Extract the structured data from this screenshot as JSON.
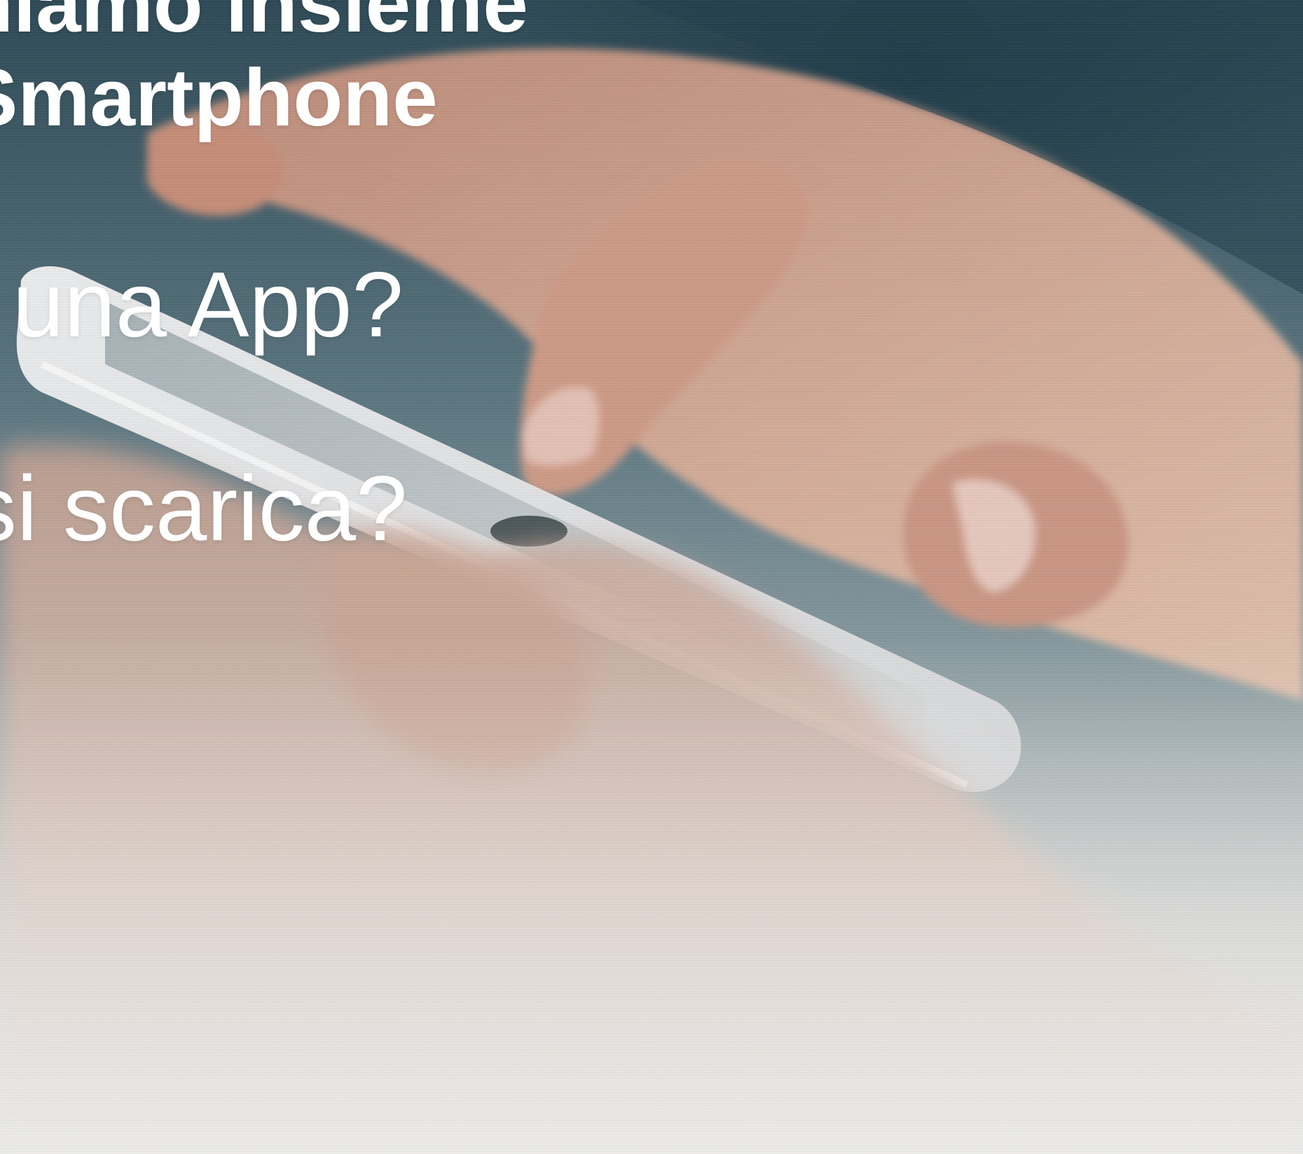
{
  "slide": {
    "title_lines": [
      "niamo insieme",
      "Smartphone"
    ],
    "bullets": [
      "una App?",
      "si scarica?"
    ]
  },
  "photo": {
    "subject": "hands-holding-smartphone",
    "colors": {
      "background_top": "#2e4a56",
      "background_bottom": "#e6e6e4",
      "skin": "#d9a98f",
      "phone_body": "#e9e9ea",
      "text": "#ffffff"
    }
  }
}
